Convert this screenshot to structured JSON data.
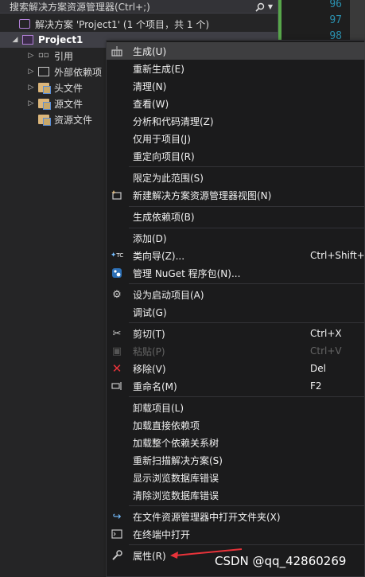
{
  "search": {
    "text": "搜索解决方案资源管理器(Ctrl+;)",
    "icon": "search-icon"
  },
  "editor": {
    "line_numbers": [
      "96",
      "97",
      "98"
    ]
  },
  "tree": {
    "solution": "解决方案 'Project1' (1 个项目，共 1 个)",
    "project": "Project1",
    "items": [
      {
        "label": "引用",
        "icon": "reference-icon"
      },
      {
        "label": "外部依赖项",
        "icon": "external-deps-icon"
      },
      {
        "label": "头文件",
        "icon": "folder-icon"
      },
      {
        "label": "源文件",
        "icon": "folder-icon"
      },
      {
        "label": "资源文件",
        "icon": "folder-icon"
      }
    ]
  },
  "menu": {
    "build": "生成(U)",
    "rebuild": "重新生成(E)",
    "clean": "清理(N)",
    "view": "查看(W)",
    "analyze": "分析和代码清理(Z)",
    "project_only": "仅用于项目(J)",
    "retarget": "重定向项目(R)",
    "scope": "限定为此范围(S)",
    "new_view": "新建解决方案资源管理器视图(N)",
    "build_deps": "生成依赖项(B)",
    "add": "添加(D)",
    "class_wizard": "类向导(Z)...",
    "class_wizard_sc": "Ctrl+Shift+X",
    "nuget": "管理 NuGet 程序包(N)...",
    "startup": "设为启动项目(A)",
    "debug": "调试(G)",
    "cut": "剪切(T)",
    "cut_sc": "Ctrl+X",
    "paste": "粘贴(P)",
    "paste_sc": "Ctrl+V",
    "remove": "移除(V)",
    "remove_sc": "Del",
    "rename": "重命名(M)",
    "rename_sc": "F2",
    "unload": "卸载项目(L)",
    "load_direct": "加载直接依赖项",
    "load_tree": "加载整个依赖关系树",
    "rescan": "重新扫描解决方案(S)",
    "show_db_errors": "显示浏览数据库错误",
    "clear_db_errors": "清除浏览数据库错误",
    "open_folder": "在文件资源管理器中打开文件夹(X)",
    "open_terminal": "在终端中打开",
    "properties": "属性(R)"
  },
  "watermark": "CSDN @qq_42860269",
  "colors": {
    "accent": "#b180d7",
    "arrow": "#e8333a",
    "line_number": "#2b91af"
  }
}
